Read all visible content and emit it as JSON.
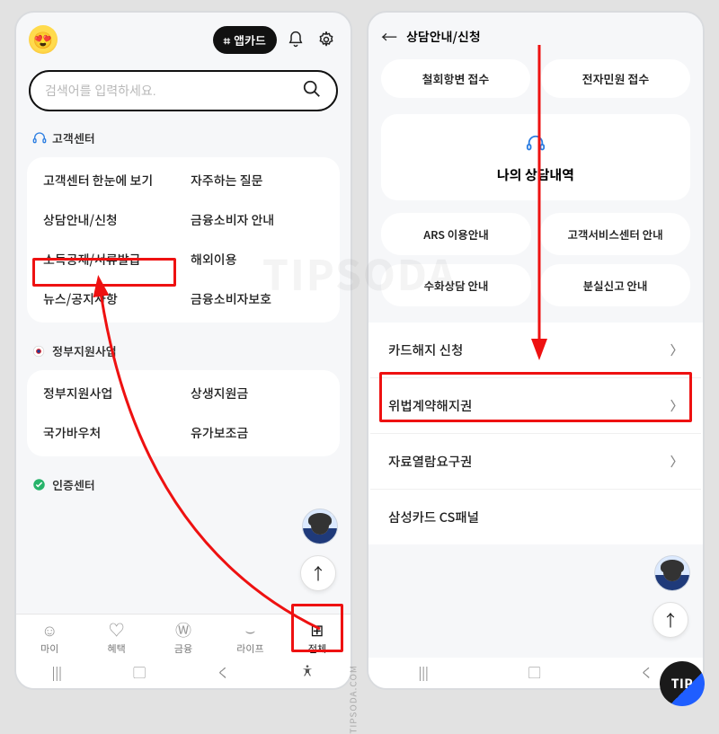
{
  "left": {
    "app_card_label": "앱카드",
    "search": {
      "placeholder": "검색어를 입력하세요."
    },
    "sections": {
      "customer_center": {
        "title": "고객센터",
        "items": [
          "고객센터 한눈에 보기",
          "자주하는 질문",
          "상담안내/신청",
          "금융소비자 안내",
          "소득공제/서류발급",
          "해외이용",
          "뉴스/공지사항",
          "금융소비자보호"
        ]
      },
      "gov_support": {
        "title": "정부지원사업",
        "items": [
          "정부지원사업",
          "상생지원금",
          "국가바우처",
          "유가보조금"
        ]
      },
      "auth_center": {
        "title": "인증센터"
      }
    },
    "navbar": {
      "items": [
        {
          "label": "마이",
          "icon": "☺"
        },
        {
          "label": "혜택",
          "icon": "♡"
        },
        {
          "label": "금융",
          "icon": "Ⓦ"
        },
        {
          "label": "라이프",
          "icon": "⌣"
        },
        {
          "label": "전체",
          "icon": "⊞"
        }
      ]
    }
  },
  "right": {
    "header_title": "상담안내/신청",
    "top_chips": [
      "철회항변 접수",
      "전자민원 접수"
    ],
    "my_card_title": "나의 상담내역",
    "info_chips": [
      "ARS 이용안내",
      "고객서비스센터 안내",
      "수화상담 안내",
      "분실신고 안내"
    ],
    "list_items": [
      "카드해지 신청",
      "위법계약해지권",
      "자료열람요구권",
      "삼성카드 CS패널"
    ]
  },
  "annotations": {
    "watermark": "TIPSODA",
    "side_text": "TIPSODA.COM",
    "tip_badge": "TIP"
  },
  "colors": {
    "highlight": "#e11"
  }
}
